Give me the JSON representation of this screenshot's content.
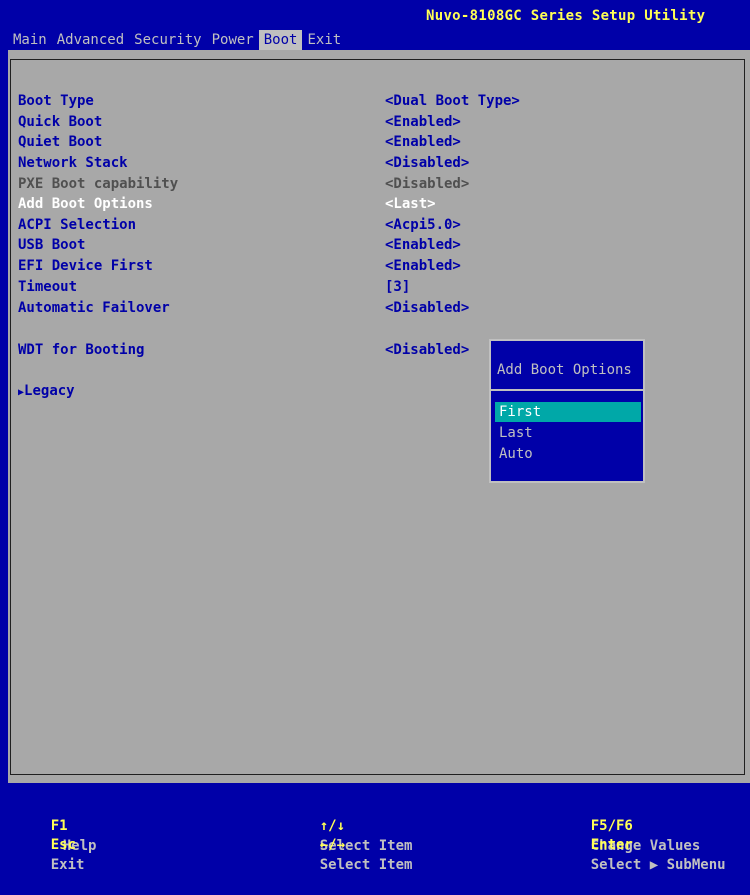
{
  "app": {
    "title": "Nuvo-8108GC Series Setup Utility"
  },
  "menu": [
    {
      "label": "Main",
      "active": false
    },
    {
      "label": "Advanced",
      "active": false
    },
    {
      "label": "Security",
      "active": false
    },
    {
      "label": "Power",
      "active": false
    },
    {
      "label": "Boot",
      "active": true
    },
    {
      "label": "Exit",
      "active": false
    }
  ],
  "settings": [
    {
      "label": "Boot Type",
      "value": "<Dual Boot Type>"
    },
    {
      "label": "Quick Boot",
      "value": "<Enabled>"
    },
    {
      "label": "Quiet Boot",
      "value": "<Enabled>"
    },
    {
      "label": "Network Stack",
      "value": "<Disabled>"
    },
    {
      "label": "PXE Boot capability",
      "value": "<Disabled>",
      "state": "disabled"
    },
    {
      "label": "Add Boot Options",
      "value": "<Last>",
      "state": "highlighted"
    },
    {
      "label": "ACPI Selection",
      "value": "<Acpi5.0>"
    },
    {
      "label": "USB Boot",
      "value": "<Enabled>"
    },
    {
      "label": "EFI Device First",
      "value": "<Enabled>"
    },
    {
      "label": "Timeout",
      "value": "[3]"
    },
    {
      "label": "Automatic Failover",
      "value": "<Disabled>"
    },
    {
      "label": "WDT for Booting",
      "value": "<Disabled>"
    },
    {
      "label": "Legacy",
      "value": "",
      "submenu": true
    }
  ],
  "popup": {
    "title": "Add Boot Options",
    "options": [
      "First",
      "Last",
      "Auto"
    ],
    "selected": "First"
  },
  "footer": {
    "help": {
      "key": "F1",
      "desc": "Help"
    },
    "exit": {
      "key": "Esc",
      "desc": "Exit"
    },
    "select_item_keys": "↑/↓",
    "select_item_desc": "Select Item",
    "select_menu_keys": "←/→",
    "select_menu_desc": "Select Item",
    "change_values_key": "F5/F6",
    "change_values_desc": "Change Values",
    "enter_key": "Enter",
    "enter_desc": "Select ▶ SubMenu"
  },
  "colors": {
    "background_blue": "#0000a8",
    "panel_gray": "#a8a8a8",
    "title_yellow": "#ffff55",
    "highlight_cyan": "#00a8a8"
  }
}
